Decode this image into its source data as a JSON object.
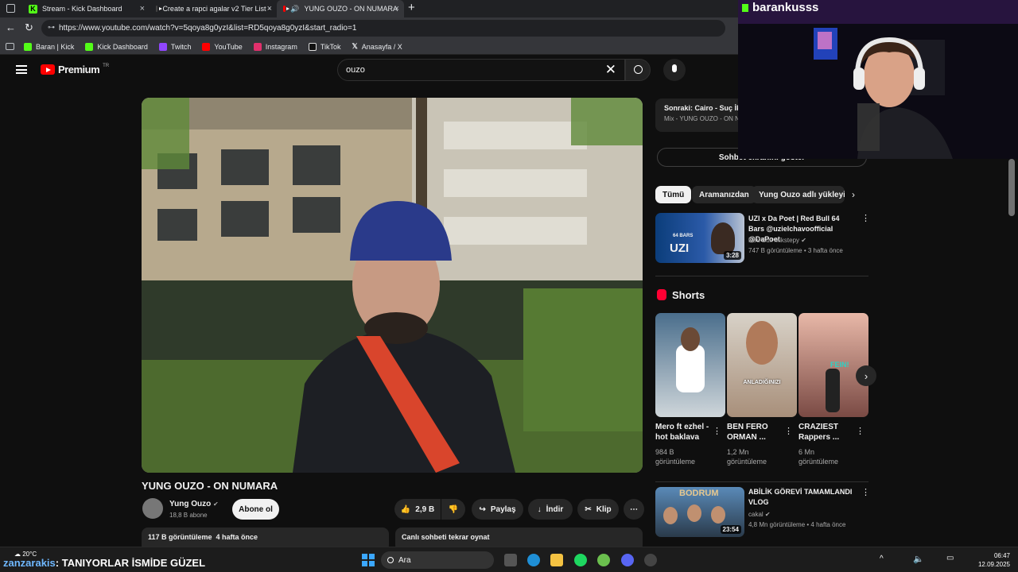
{
  "browser": {
    "tabs": [
      {
        "label": "Stream - Kick Dashboard"
      },
      {
        "label": "Create a rapci agalar v2 Tier List -"
      },
      {
        "label": "YUNG OUZO - ON NUMARA"
      }
    ],
    "url": "https://www.youtube.com/watch?v=5qoya8g0yzI&list=RD5qoya8g0yzI&start_radio=1",
    "bookmarks": [
      {
        "label": "Baran | Kick",
        "color": "#53fc18"
      },
      {
        "label": "Kick Dashboard",
        "color": "#53fc18"
      },
      {
        "label": "Twitch",
        "color": "#9146ff"
      },
      {
        "label": "YouTube",
        "color": "#ff0000"
      },
      {
        "label": "Instagram",
        "color": "#e1306c"
      },
      {
        "label": "TikTok",
        "color": "#ffffff"
      },
      {
        "label": "Anasayfa / X",
        "color": "#ffffff"
      }
    ]
  },
  "youtube": {
    "logo": "Premium",
    "region": "TR",
    "search_value": "ouzo",
    "video": {
      "title": "YUNG OUZO - ON NUMARA",
      "channel": "Yung Ouzo",
      "subscribers": "18,8 B abone",
      "subscribe": "Abone ol",
      "likes": "2,9 B",
      "share": "Paylaş",
      "download": "İndir",
      "clip": "Klip",
      "views": "117 B görüntüleme",
      "age": "4 hafta önce",
      "chat_replay": "Canlı sohbeti tekrar oynat"
    },
    "mix": {
      "next": "Sonraki: Cairo - Suç İki",
      "sub": "Mix - YUNG OUZO - ON NU"
    },
    "chat_button": "Sohbet ekranını göster",
    "chips": [
      "Tümü",
      "Aramanızdan",
      "Yung Ouzo adlı yükleyic"
    ],
    "rec1": {
      "title": "UZI x Da Poet | Red Bull 64 Bars @uzielchavoofficial @DaPoet",
      "channel": "Red Bull Mikstepy",
      "meta": "747 B görüntüleme • 3 hafta önce",
      "duration": "3:28",
      "thumb_text": "UZI",
      "badge": "64 BARS"
    },
    "shorts_label": "Shorts",
    "shorts": [
      {
        "title": "Mero ft ezhel - hot baklava",
        "views": "984 B",
        "views_suffix": "görüntüleme"
      },
      {
        "title": "BEN FERO ORMAN ...",
        "views": "1,2 Mn",
        "views_suffix": "görüntüleme",
        "overlay": "ANLADIĞINIZI"
      },
      {
        "title": "CRAZIEST Rappers ...",
        "views": "6 Mn",
        "views_suffix": "görüntüleme",
        "overlay": "FEIN!"
      }
    ],
    "rec2": {
      "title": "ABİLİK GÖREVİ TAMAMLANDI VLOG",
      "channel": "cakal",
      "meta": "4,8 Mn görüntüleme • 4 hafta önce",
      "duration": "23:54",
      "thumb_text": "BODRUM"
    }
  },
  "overlay": {
    "streamer": "barankusss",
    "ticker_user": "zanzarakis",
    "ticker_text": "TANIYORLAR İSMİDE GÜZEL"
  },
  "taskbar": {
    "weather": "20°C",
    "search": "Ara",
    "time": "06:47",
    "date": "12.09.2025"
  }
}
